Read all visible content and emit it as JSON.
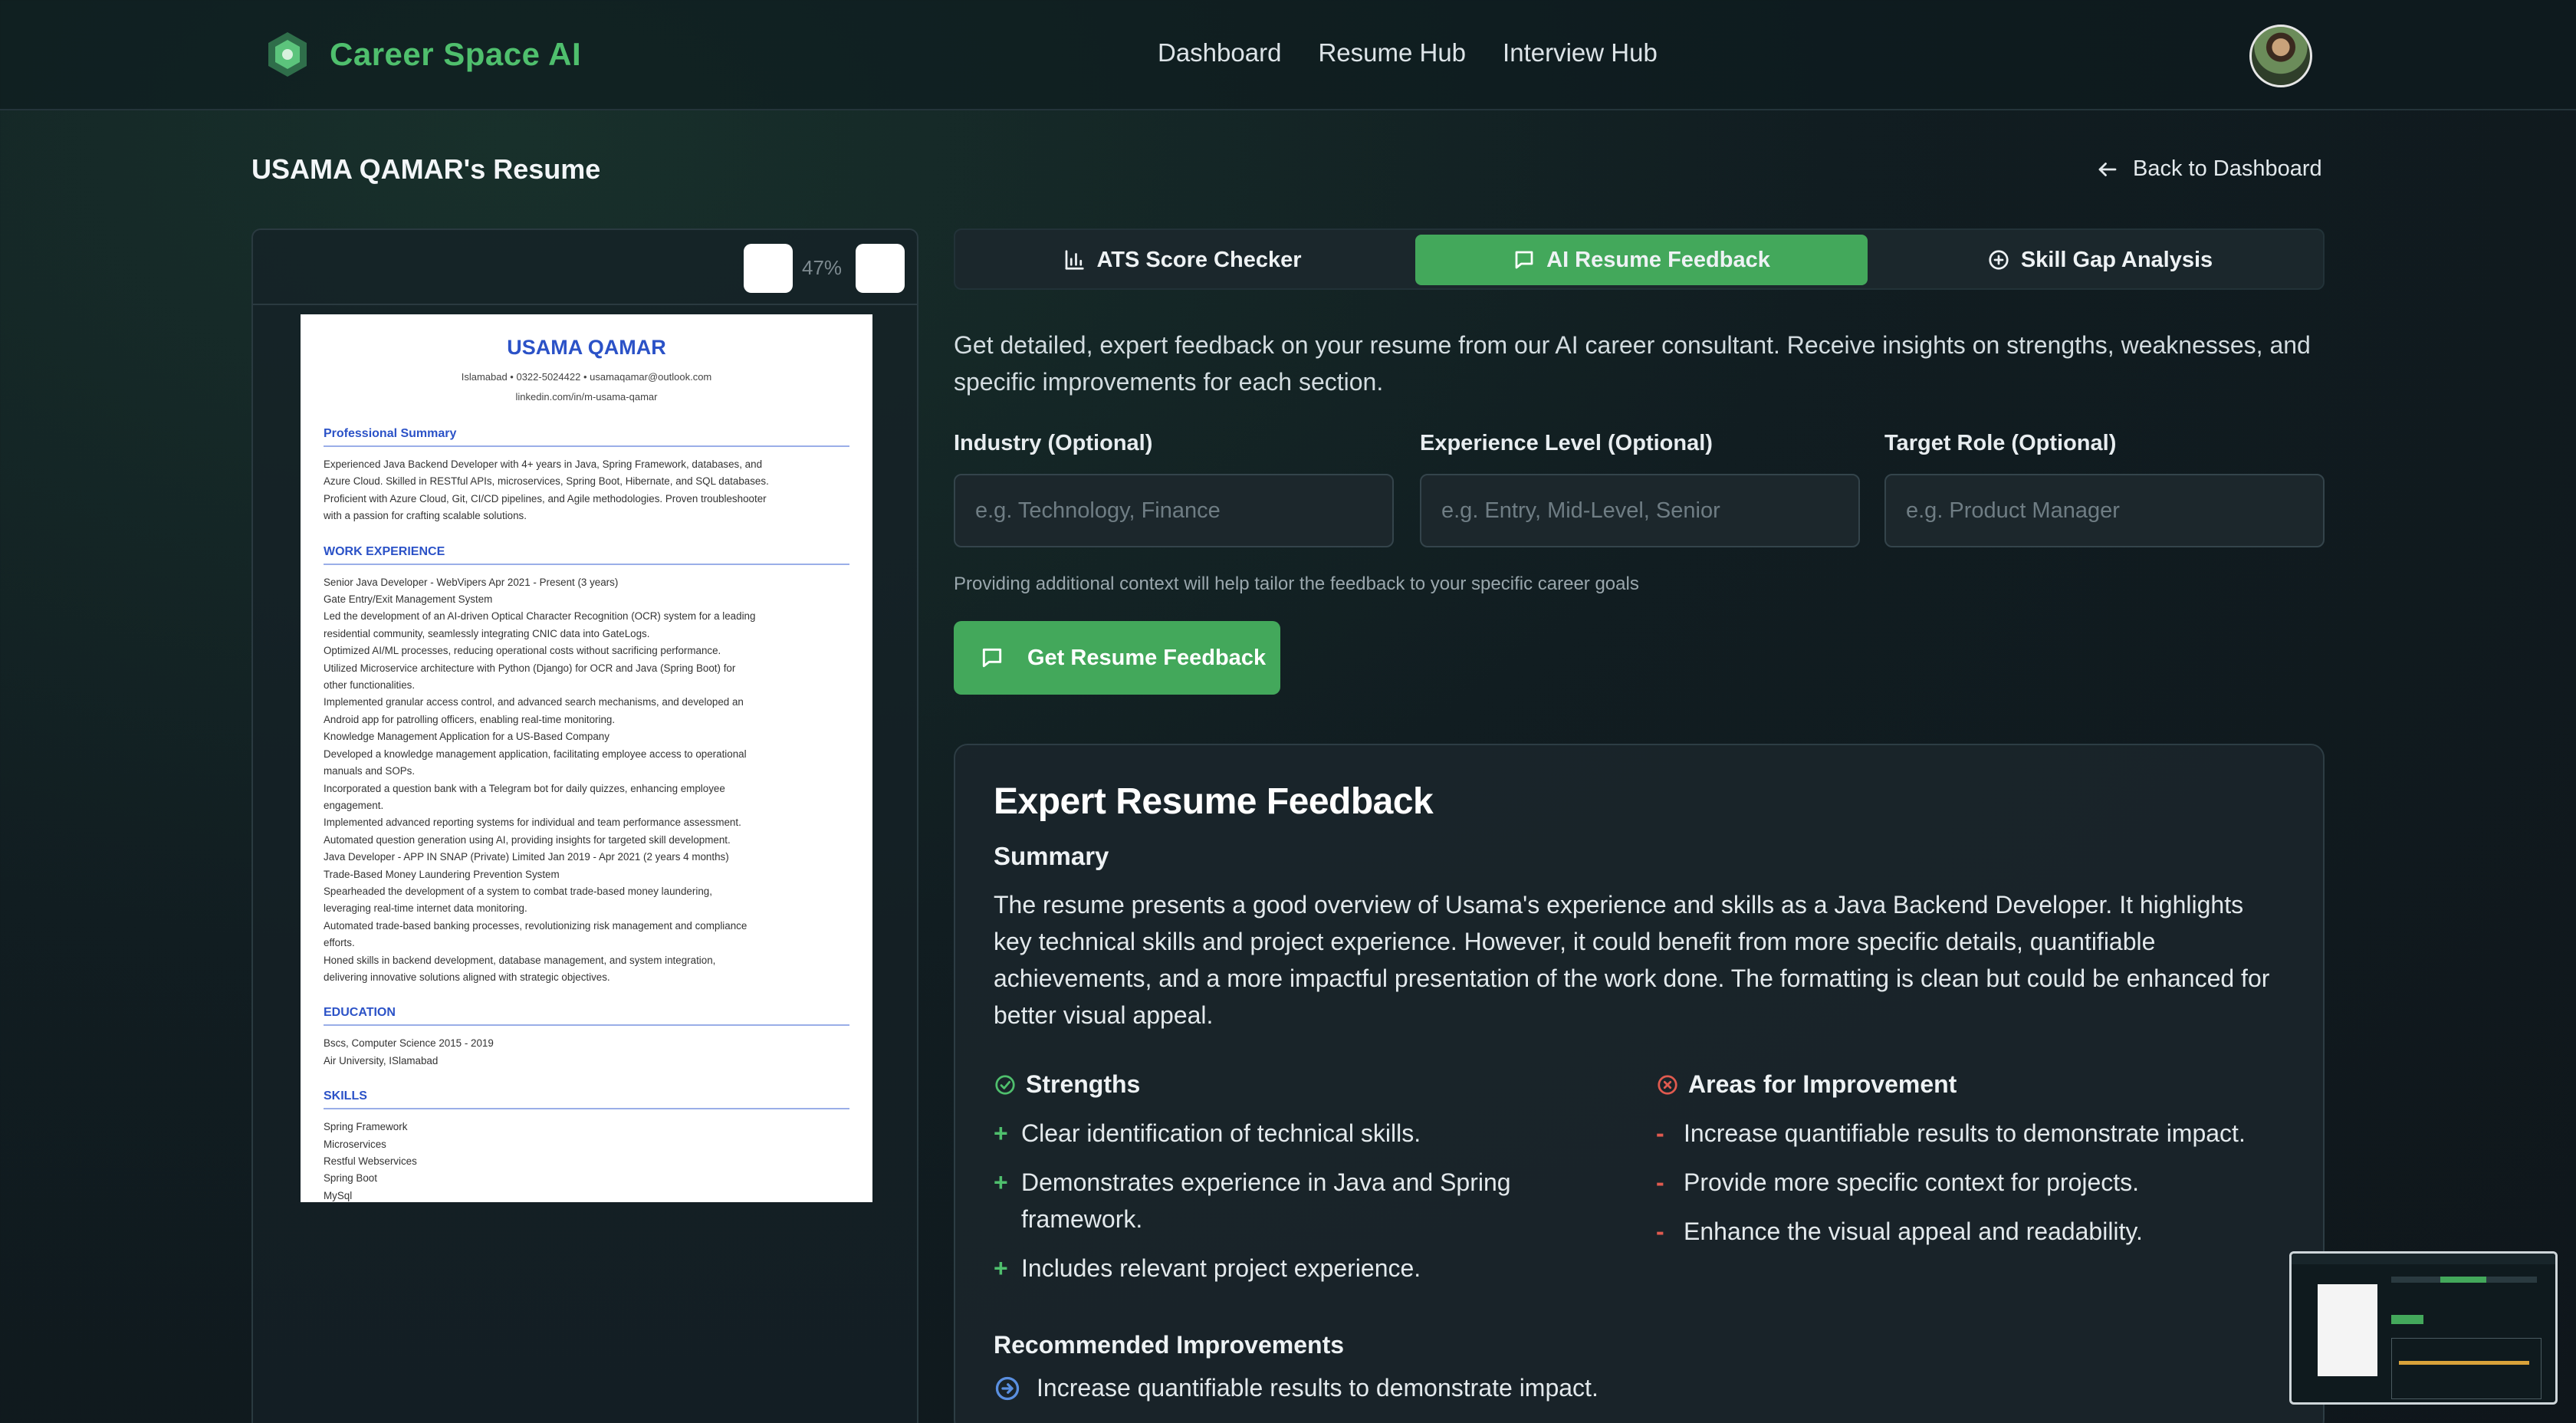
{
  "header": {
    "brand": "Career Space AI",
    "nav": [
      "Dashboard",
      "Resume Hub",
      "Interview Hub"
    ]
  },
  "page": {
    "title": "USAMA QAMAR's Resume",
    "back_label": "Back to Dashboard"
  },
  "preview": {
    "zoom_level": "47%",
    "resume": {
      "name": "USAMA QAMAR",
      "contact_line1": "Islamabad  •  0322-5024422  •  usamaqamar@outlook.com",
      "contact_line2": "linkedin.com/in/m-usama-qamar",
      "sections": {
        "summary_heading": "Professional Summary",
        "summary_lines": [
          "Experienced Java Backend Developer with 4+ years in Java, Spring Framework, databases, and",
          "Azure Cloud. Skilled in RESTful APIs, microservices, Spring Boot, Hibernate, and SQL databases.",
          "Proficient with Azure Cloud, Git, CI/CD pipelines, and Agile methodologies. Proven troubleshooter",
          "with a passion for crafting scalable solutions."
        ],
        "experience_heading": "WORK EXPERIENCE",
        "experience_lines": [
          "Senior Java Developer - WebVipers Apr 2021 - Present (3 years)",
          "Gate Entry/Exit Management System",
          "Led the development of an AI-driven Optical Character Recognition (OCR) system for a leading",
          "residential community, seamlessly integrating CNIC data into GateLogs.",
          "Optimized AI/ML processes, reducing operational costs without sacrificing performance.",
          "Utilized Microservice architecture with Python (Django) for OCR and Java (Spring Boot) for",
          "other functionalities.",
          "Implemented granular access control, and advanced search mechanisms, and developed an",
          "Android app for patrolling officers, enabling real-time monitoring.",
          "Knowledge Management Application for a US-Based Company",
          "Developed a knowledge management application, facilitating employee access to operational",
          "manuals and SOPs.",
          "Incorporated a question bank with a Telegram bot for daily quizzes, enhancing employee",
          "engagement.",
          "Implemented advanced reporting systems for individual and team performance assessment.",
          "Automated question generation using AI, providing insights for targeted skill development.",
          "Java Developer - APP IN SNAP (Private) Limited Jan 2019 - Apr 2021 (2 years 4 months)",
          "Trade-Based Money Laundering Prevention System",
          "Spearheaded the development of a system to combat trade-based money laundering,",
          "leveraging real-time internet data monitoring.",
          "Automated trade-based banking processes, revolutionizing risk management and compliance",
          "efforts.",
          "Honed skills in backend development, database management, and system integration,",
          "delivering innovative solutions aligned with strategic objectives."
        ],
        "education_heading": "EDUCATION",
        "education_lines": [
          "Bscs, Computer Science 2015 - 2019",
          "Air University, ISlamabad"
        ],
        "skills_heading": "SKILLS",
        "skills_lines": [
          "Spring Framework",
          "Microservices",
          "Restful Webservices",
          "Spring Boot",
          "MySql"
        ]
      }
    }
  },
  "tabs": [
    {
      "label": "ATS Score Checker",
      "icon": "bar-chart-icon",
      "active": false
    },
    {
      "label": "AI Resume Feedback",
      "icon": "message-square-icon",
      "active": true
    },
    {
      "label": "Skill Gap Analysis",
      "icon": "plus-circle-icon",
      "active": false
    }
  ],
  "form": {
    "intro": "Get detailed, expert feedback on your resume from our AI career consultant. Receive insights on strengths, weaknesses, and specific improvements for each section.",
    "industry_label": "Industry (Optional)",
    "industry_placeholder": "e.g. Technology, Finance",
    "experience_label": "Experience Level (Optional)",
    "experience_placeholder": "e.g. Entry, Mid-Level, Senior",
    "role_label": "Target Role (Optional)",
    "role_placeholder": "e.g. Product Manager",
    "helper": "Providing additional context will help tailor the feedback to your specific career goals",
    "submit_label": "Get Resume Feedback"
  },
  "feedback": {
    "title": "Expert Resume Feedback",
    "summary_heading": "Summary",
    "summary": "The resume presents a good overview of Usama's experience and skills as a Java Backend Developer. It highlights key technical skills and project experience. However, it could benefit from more specific details, quantifiable achievements, and a more impactful presentation of the work done. The formatting is clean but could be enhanced for better visual appeal.",
    "strengths_heading": "Strengths",
    "strengths": [
      "Clear identification of technical skills.",
      "Demonstrates experience in Java and Spring framework.",
      "Includes relevant project experience."
    ],
    "improvements_heading": "Areas for Improvement",
    "improvements": [
      "Increase quantifiable results to demonstrate impact.",
      "Provide more specific context for projects.",
      "Enhance the visual appeal and readability."
    ],
    "recommended_heading": "Recommended Improvements",
    "recommended": [
      "Increase quantifiable results to demonstrate impact."
    ]
  },
  "colors": {
    "accent_green": "#43a85b",
    "brand_green": "#4fbf6d",
    "improvement_red": "#e05a4f",
    "resume_blue": "#2b52c7"
  }
}
